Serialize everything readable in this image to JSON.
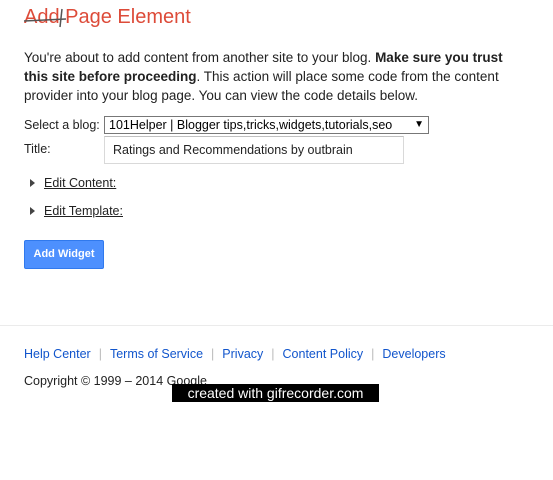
{
  "page_title": "Add Page Element",
  "intro": {
    "part1": "You're about to add content from another site to your blog. ",
    "bold": "Make sure you trust this site before proceeding",
    "part2": ". This action will place some code from the content provider into your blog page. You can view the code details below."
  },
  "form": {
    "blog_label": "Select a blog:",
    "blog_selected": "101Helper | Blogger tips,tricks,widgets,tutorials,seo",
    "title_label": "Title:",
    "title_value": "Ratings and Recommendations by outbrain"
  },
  "expanders": {
    "edit_content": "Edit Content:",
    "edit_template": "Edit Template:"
  },
  "add_widget_label": "Add Widget",
  "footer": {
    "links": [
      "Help Center",
      "Terms of Service",
      "Privacy",
      "Content Policy",
      "Developers"
    ],
    "copyright": "Copyright © 1999 – 2014 Google"
  },
  "watermark": "created with gifrecorder.com",
  "colors": {
    "title": "#dd4b39",
    "button": "#4d90fe",
    "link": "#1155cc"
  }
}
